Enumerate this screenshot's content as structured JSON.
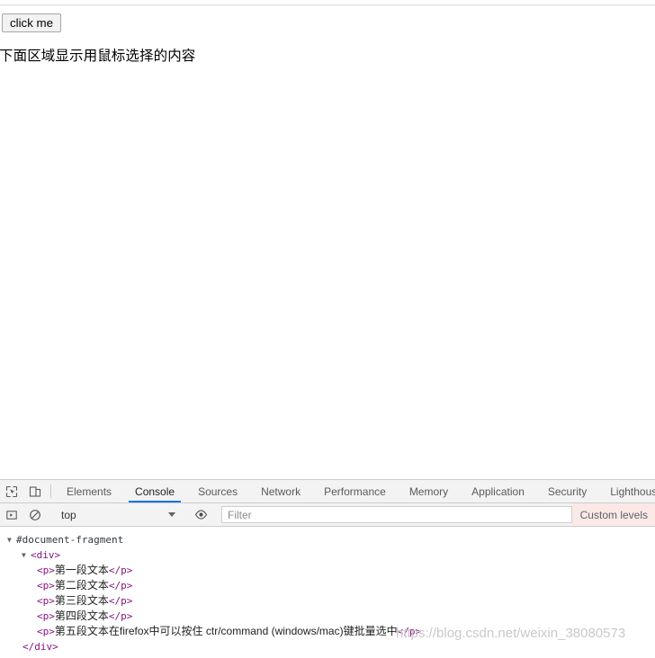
{
  "page": {
    "button_label": "click me",
    "heading": "下面区域显示用鼠标选择的内容",
    "selection_output": ""
  },
  "devtools": {
    "icons": {
      "inspect": "inspect-element-icon",
      "device": "device-toolbar-icon",
      "execute": "execution-context-icon",
      "clear": "clear-console-icon",
      "eye": "console-sidebar-eye-icon",
      "caret": "chevron-down-icon"
    },
    "tabs": [
      {
        "label": "Elements",
        "active": false
      },
      {
        "label": "Console",
        "active": true
      },
      {
        "label": "Sources",
        "active": false
      },
      {
        "label": "Network",
        "active": false
      },
      {
        "label": "Performance",
        "active": false
      },
      {
        "label": "Memory",
        "active": false
      },
      {
        "label": "Application",
        "active": false
      },
      {
        "label": "Security",
        "active": false
      },
      {
        "label": "Lighthouse",
        "active": false
      }
    ],
    "active_tab": "Console",
    "filterbar": {
      "context_value": "top",
      "filter_value": "",
      "filter_placeholder": "Filter",
      "levels_label": "Custom levels"
    },
    "console_output": {
      "root_label": "#document-fragment",
      "div_open": "<div>",
      "div_close": "</div>",
      "paragraphs": [
        {
          "open": "<p>",
          "text": "第一段文本",
          "close": "</p>"
        },
        {
          "open": "<p>",
          "text": "第二段文本",
          "close": "</p>"
        },
        {
          "open": "<p>",
          "text": "第三段文本",
          "close": "</p>"
        },
        {
          "open": "<p>",
          "text": "第四段文本",
          "close": "</p>"
        },
        {
          "open": "<p>",
          "text": "第五段文本在firefox中可以按住 ctr/command (windows/mac)键批量选中",
          "close": "</p>"
        }
      ]
    }
  },
  "watermark": "https://blog.csdn.net/weixin_38080573",
  "colors": {
    "accent": "#1a73e8",
    "tag": "#881280",
    "toolbar_bg": "#f3f3f3",
    "levels_bg": "#fbe9e7"
  }
}
